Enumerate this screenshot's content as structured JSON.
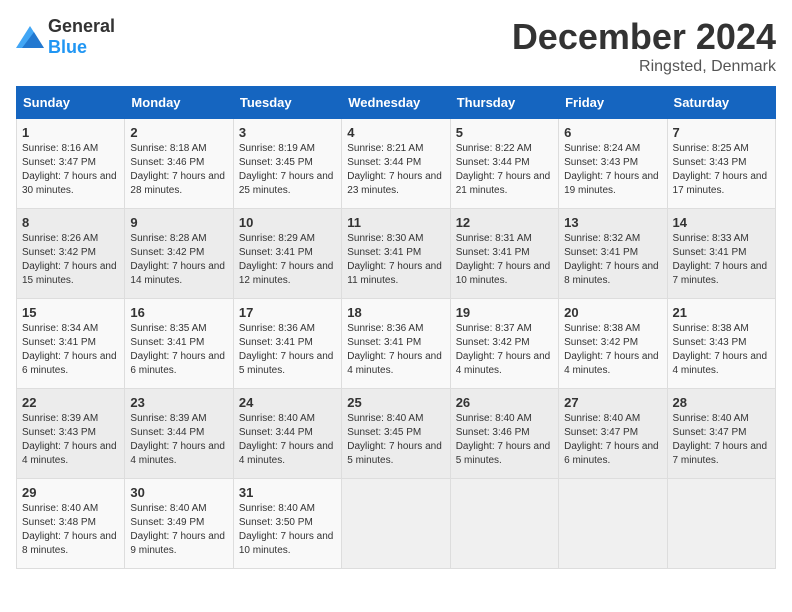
{
  "header": {
    "logo_general": "General",
    "logo_blue": "Blue",
    "month": "December 2024",
    "location": "Ringsted, Denmark"
  },
  "days_of_week": [
    "Sunday",
    "Monday",
    "Tuesday",
    "Wednesday",
    "Thursday",
    "Friday",
    "Saturday"
  ],
  "weeks": [
    [
      {
        "day": "1",
        "sunrise": "Sunrise: 8:16 AM",
        "sunset": "Sunset: 3:47 PM",
        "daylight": "Daylight: 7 hours and 30 minutes."
      },
      {
        "day": "2",
        "sunrise": "Sunrise: 8:18 AM",
        "sunset": "Sunset: 3:46 PM",
        "daylight": "Daylight: 7 hours and 28 minutes."
      },
      {
        "day": "3",
        "sunrise": "Sunrise: 8:19 AM",
        "sunset": "Sunset: 3:45 PM",
        "daylight": "Daylight: 7 hours and 25 minutes."
      },
      {
        "day": "4",
        "sunrise": "Sunrise: 8:21 AM",
        "sunset": "Sunset: 3:44 PM",
        "daylight": "Daylight: 7 hours and 23 minutes."
      },
      {
        "day": "5",
        "sunrise": "Sunrise: 8:22 AM",
        "sunset": "Sunset: 3:44 PM",
        "daylight": "Daylight: 7 hours and 21 minutes."
      },
      {
        "day": "6",
        "sunrise": "Sunrise: 8:24 AM",
        "sunset": "Sunset: 3:43 PM",
        "daylight": "Daylight: 7 hours and 19 minutes."
      },
      {
        "day": "7",
        "sunrise": "Sunrise: 8:25 AM",
        "sunset": "Sunset: 3:43 PM",
        "daylight": "Daylight: 7 hours and 17 minutes."
      }
    ],
    [
      {
        "day": "8",
        "sunrise": "Sunrise: 8:26 AM",
        "sunset": "Sunset: 3:42 PM",
        "daylight": "Daylight: 7 hours and 15 minutes."
      },
      {
        "day": "9",
        "sunrise": "Sunrise: 8:28 AM",
        "sunset": "Sunset: 3:42 PM",
        "daylight": "Daylight: 7 hours and 14 minutes."
      },
      {
        "day": "10",
        "sunrise": "Sunrise: 8:29 AM",
        "sunset": "Sunset: 3:41 PM",
        "daylight": "Daylight: 7 hours and 12 minutes."
      },
      {
        "day": "11",
        "sunrise": "Sunrise: 8:30 AM",
        "sunset": "Sunset: 3:41 PM",
        "daylight": "Daylight: 7 hours and 11 minutes."
      },
      {
        "day": "12",
        "sunrise": "Sunrise: 8:31 AM",
        "sunset": "Sunset: 3:41 PM",
        "daylight": "Daylight: 7 hours and 10 minutes."
      },
      {
        "day": "13",
        "sunrise": "Sunrise: 8:32 AM",
        "sunset": "Sunset: 3:41 PM",
        "daylight": "Daylight: 7 hours and 8 minutes."
      },
      {
        "day": "14",
        "sunrise": "Sunrise: 8:33 AM",
        "sunset": "Sunset: 3:41 PM",
        "daylight": "Daylight: 7 hours and 7 minutes."
      }
    ],
    [
      {
        "day": "15",
        "sunrise": "Sunrise: 8:34 AM",
        "sunset": "Sunset: 3:41 PM",
        "daylight": "Daylight: 7 hours and 6 minutes."
      },
      {
        "day": "16",
        "sunrise": "Sunrise: 8:35 AM",
        "sunset": "Sunset: 3:41 PM",
        "daylight": "Daylight: 7 hours and 6 minutes."
      },
      {
        "day": "17",
        "sunrise": "Sunrise: 8:36 AM",
        "sunset": "Sunset: 3:41 PM",
        "daylight": "Daylight: 7 hours and 5 minutes."
      },
      {
        "day": "18",
        "sunrise": "Sunrise: 8:36 AM",
        "sunset": "Sunset: 3:41 PM",
        "daylight": "Daylight: 7 hours and 4 minutes."
      },
      {
        "day": "19",
        "sunrise": "Sunrise: 8:37 AM",
        "sunset": "Sunset: 3:42 PM",
        "daylight": "Daylight: 7 hours and 4 minutes."
      },
      {
        "day": "20",
        "sunrise": "Sunrise: 8:38 AM",
        "sunset": "Sunset: 3:42 PM",
        "daylight": "Daylight: 7 hours and 4 minutes."
      },
      {
        "day": "21",
        "sunrise": "Sunrise: 8:38 AM",
        "sunset": "Sunset: 3:43 PM",
        "daylight": "Daylight: 7 hours and 4 minutes."
      }
    ],
    [
      {
        "day": "22",
        "sunrise": "Sunrise: 8:39 AM",
        "sunset": "Sunset: 3:43 PM",
        "daylight": "Daylight: 7 hours and 4 minutes."
      },
      {
        "day": "23",
        "sunrise": "Sunrise: 8:39 AM",
        "sunset": "Sunset: 3:44 PM",
        "daylight": "Daylight: 7 hours and 4 minutes."
      },
      {
        "day": "24",
        "sunrise": "Sunrise: 8:40 AM",
        "sunset": "Sunset: 3:44 PM",
        "daylight": "Daylight: 7 hours and 4 minutes."
      },
      {
        "day": "25",
        "sunrise": "Sunrise: 8:40 AM",
        "sunset": "Sunset: 3:45 PM",
        "daylight": "Daylight: 7 hours and 5 minutes."
      },
      {
        "day": "26",
        "sunrise": "Sunrise: 8:40 AM",
        "sunset": "Sunset: 3:46 PM",
        "daylight": "Daylight: 7 hours and 5 minutes."
      },
      {
        "day": "27",
        "sunrise": "Sunrise: 8:40 AM",
        "sunset": "Sunset: 3:47 PM",
        "daylight": "Daylight: 7 hours and 6 minutes."
      },
      {
        "day": "28",
        "sunrise": "Sunrise: 8:40 AM",
        "sunset": "Sunset: 3:47 PM",
        "daylight": "Daylight: 7 hours and 7 minutes."
      }
    ],
    [
      {
        "day": "29",
        "sunrise": "Sunrise: 8:40 AM",
        "sunset": "Sunset: 3:48 PM",
        "daylight": "Daylight: 7 hours and 8 minutes."
      },
      {
        "day": "30",
        "sunrise": "Sunrise: 8:40 AM",
        "sunset": "Sunset: 3:49 PM",
        "daylight": "Daylight: 7 hours and 9 minutes."
      },
      {
        "day": "31",
        "sunrise": "Sunrise: 8:40 AM",
        "sunset": "Sunset: 3:50 PM",
        "daylight": "Daylight: 7 hours and 10 minutes."
      },
      null,
      null,
      null,
      null
    ]
  ]
}
